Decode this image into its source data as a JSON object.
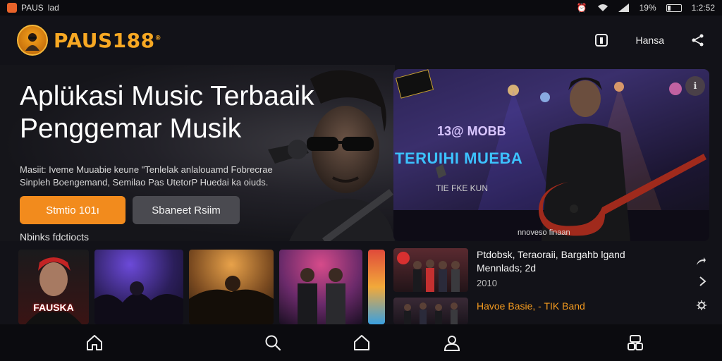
{
  "status_bar": {
    "app_name": "PAUS",
    "extra": "lad",
    "battery": "19%",
    "time": "1:2:52"
  },
  "header": {
    "logo_text": "PAUS188",
    "logo_mark": "®",
    "menu_label": "Hansa"
  },
  "hero": {
    "title_line1": "Aplükasi Music Terbaaik",
    "title_line2": "Penggemar Musik",
    "desc_line1": "Masiit: Iveme Muuabie keune \"Tenlelak anlalouamd Fobrecrae",
    "desc_line2": "Sinpleh Boengemand, Semilao Pas UtetorP Huedai ka oiuds.",
    "primary_button": "Stmtio 101ı",
    "secondary_button": "Sbaneet Rsiim",
    "section_label": "Nbinks fdctiocts"
  },
  "thumbnails": [
    {
      "caption": "FAUSKA"
    },
    {
      "caption": ""
    },
    {
      "caption": ""
    },
    {
      "caption": ""
    },
    {
      "caption": ""
    }
  ],
  "feature": {
    "heading1": "13@ MOBB",
    "heading2": "TERUIHI MUEBA",
    "subtitle": "TIE FKE KUN",
    "caption": "nnoveso finaan"
  },
  "list": [
    {
      "title": "Ptdobsk, Teraoraii, Bargahb lgand",
      "subtitle": "Mennlads;  2d",
      "year": "2010"
    },
    {
      "title": "Havoe Basie, - TIK Band"
    }
  ],
  "colors": {
    "accent": "#f28b1d",
    "logo": "#f7a823",
    "background": "#121218"
  }
}
